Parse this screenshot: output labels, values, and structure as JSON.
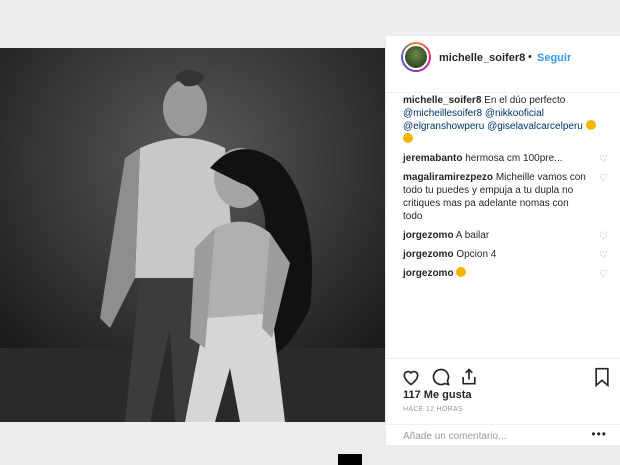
{
  "post": {
    "username": "michelle_soifer8",
    "separator": "•",
    "follow_label": "Seguir",
    "caption": {
      "author": "michelle_soifer8",
      "text": "En el dúo perfecto",
      "mentions": [
        "@micheillesoifer8",
        "@nikkooficial",
        "@elgranshowperu",
        "@giselavalcarcelperu"
      ]
    },
    "comments": [
      {
        "author": "jeremabanto",
        "text": "hermosa cm 100pre..."
      },
      {
        "author": "magaliramirezpezo",
        "text": "Micheille vamos con todo tu puedes y empuja a tu dupla no critiques mas pa adelante nomas con todo"
      },
      {
        "author": "jorgezomo",
        "text": "A bailar"
      },
      {
        "author": "jorgezomo",
        "text": "Opcion 4"
      },
      {
        "author": "jorgezomo",
        "text": ""
      }
    ],
    "likes": "117 Me gusta",
    "timestamp": "HACE 12 HORAS",
    "add_comment_placeholder": "Añade un comentario...",
    "more_options": "•••"
  },
  "icons": {
    "heart": "heart-icon",
    "comment": "comment-icon",
    "share": "share-icon",
    "bookmark": "bookmark-icon"
  }
}
